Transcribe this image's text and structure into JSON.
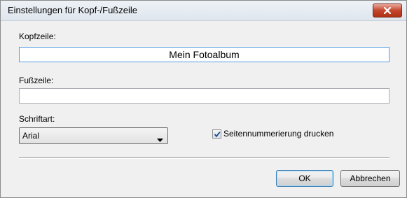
{
  "window": {
    "title": "Einstellungen für Kopf-/Fußzeile",
    "close_icon": "close-icon"
  },
  "header": {
    "label": "Kopfzeile:",
    "value": "Mein Fotoalbum"
  },
  "footer": {
    "label": "Fußzeile:",
    "value": ""
  },
  "font": {
    "label": "Schriftart:",
    "selected": "Arial"
  },
  "page_numbering": {
    "label": "Seitennummerierung drucken",
    "checked": true
  },
  "buttons": {
    "ok_label": "OK",
    "cancel_label": "Abbrechen"
  },
  "colors": {
    "close_button": "#c4452e",
    "focus_border": "#569de5",
    "default_button_border": "#3c7fb1"
  }
}
